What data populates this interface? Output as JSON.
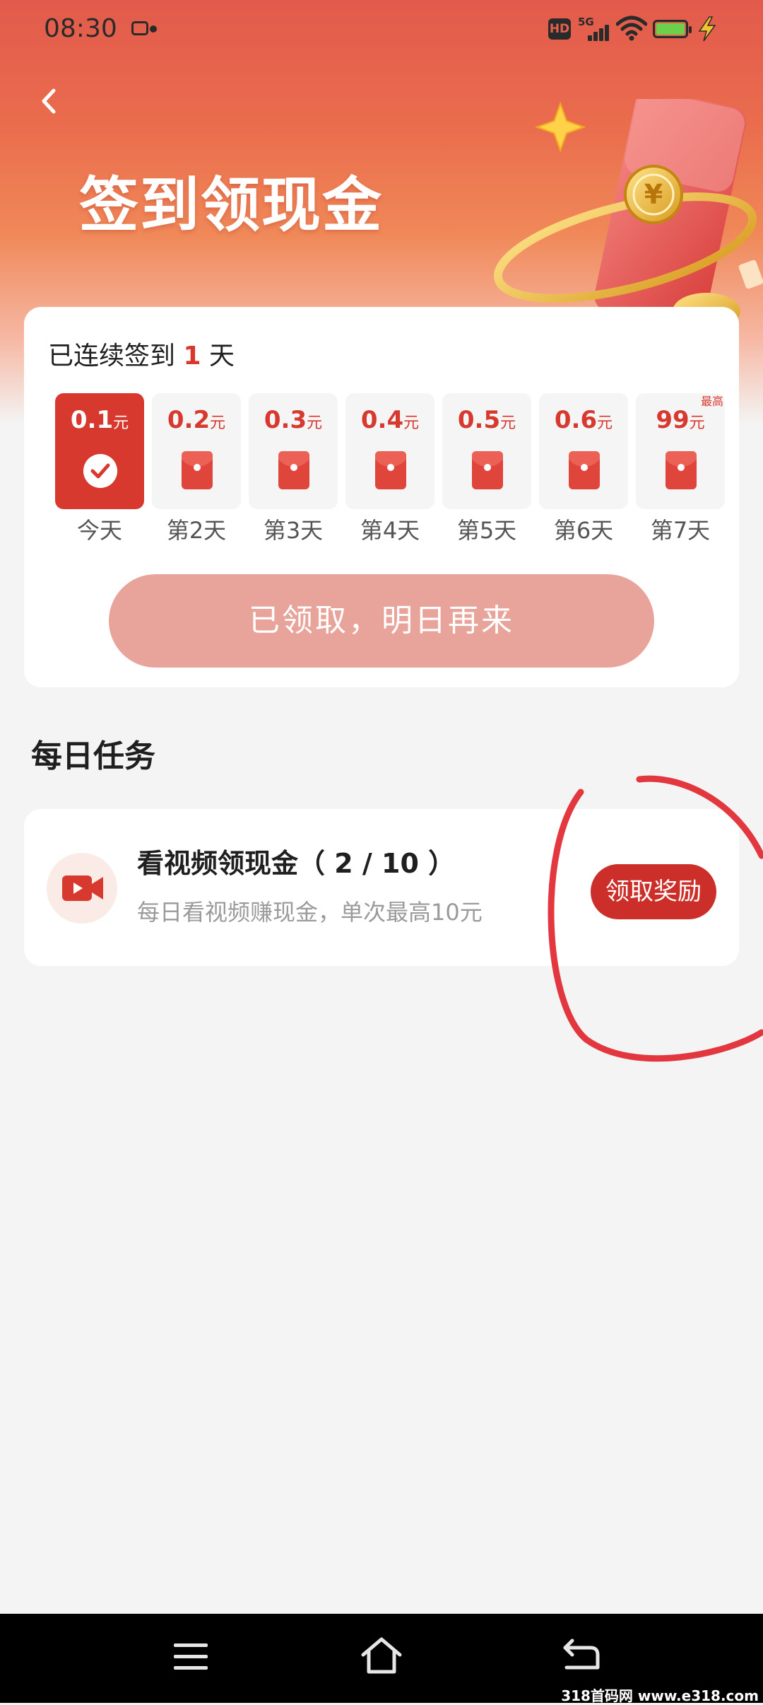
{
  "status_bar": {
    "time": "08:30",
    "hd_label": "HD",
    "network_label": "5G",
    "icons": [
      "notification-icon",
      "hd-icon",
      "signal-icon",
      "wifi-icon",
      "battery-icon",
      "charging-bolt-icon"
    ]
  },
  "header": {
    "title": "签到领现金",
    "back_icon": "chevron-left-icon"
  },
  "signin": {
    "streak_prefix": "已连续签到",
    "streak_days": "1",
    "streak_suffix": "天",
    "days": [
      {
        "amount": "0.1",
        "unit": "元",
        "label": "今天",
        "status": "claimed"
      },
      {
        "amount": "0.2",
        "unit": "元",
        "label": "第2天",
        "status": "pending"
      },
      {
        "amount": "0.3",
        "unit": "元",
        "label": "第3天",
        "status": "pending"
      },
      {
        "amount": "0.4",
        "unit": "元",
        "label": "第4天",
        "status": "pending"
      },
      {
        "amount": "0.5",
        "unit": "元",
        "label": "第5天",
        "status": "pending"
      },
      {
        "amount": "0.6",
        "unit": "元",
        "label": "第6天",
        "status": "pending"
      },
      {
        "amount": "99",
        "unit": "元",
        "label": "第7天",
        "status": "pending",
        "badge": "最高"
      }
    ],
    "claim_button": "已领取，明日再来"
  },
  "tasks": {
    "section_title": "每日任务",
    "items": [
      {
        "title": "看视频领现金（ 2 / 10 ）",
        "description": "每日看视频赚现金，单次最高10元",
        "button": "领取奖励",
        "icon": "video-camera-icon"
      }
    ]
  },
  "nav_bar": {
    "icons": [
      "menu-icon",
      "home-icon",
      "back-icon"
    ]
  },
  "watermark": "318首码网 www.e318.com",
  "colors": {
    "accent": "#d7392f",
    "claimed_button": "#e8a39a",
    "reward_button": "#cc2f2a",
    "annotation": "#e0222a"
  }
}
